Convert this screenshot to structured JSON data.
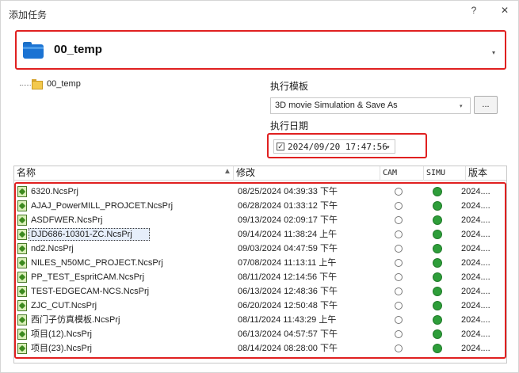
{
  "window": {
    "title": "添加任务",
    "help_label": "?",
    "close_label": "✕"
  },
  "folder_combo": {
    "name": "00_temp",
    "icon": "folder-icon",
    "arrow": "▾"
  },
  "tree": {
    "item_label": "00_temp"
  },
  "template": {
    "label": "执行模板",
    "selected": "3D movie Simulation  & Save As",
    "arrow": "▾",
    "browse_label": "..."
  },
  "exec_date": {
    "label": "执行日期",
    "checked": true,
    "check_mark": "✓",
    "value": "2024/09/20 17:47:56",
    "arrow": "▾"
  },
  "grid": {
    "columns": {
      "name": "名称",
      "modified": "修改",
      "cam": "CAM",
      "simu": "SIMU",
      "version": "版本"
    },
    "sort_arrow": "▲",
    "rows": [
      {
        "name": "6320.NcsPrj",
        "modified": "08/25/2024 04:39:33 下午",
        "version": "2024...."
      },
      {
        "name": "AJAJ_PowerMILL_PROJCET.NcsPrj",
        "modified": "06/28/2024 01:33:12 下午",
        "version": "2024...."
      },
      {
        "name": "ASDFWER.NcsPrj",
        "modified": "09/13/2024 02:09:17 下午",
        "version": "2024...."
      },
      {
        "name": "DJD686-10301-ZC.NcsPrj",
        "modified": "09/14/2024 11:38:24 上午",
        "version": "2024...."
      },
      {
        "name": "nd2.NcsPrj",
        "modified": "09/03/2024 04:47:59 下午",
        "version": "2024...."
      },
      {
        "name": "NILES_N50MC_PROJECT.NcsPrj",
        "modified": "07/08/2024 11:13:11 上午",
        "version": "2024...."
      },
      {
        "name": "PP_TEST_EspritCAM.NcsPrj",
        "modified": "08/11/2024 12:14:56 下午",
        "version": "2024...."
      },
      {
        "name": "TEST-EDGECAM-NCS.NcsPrj",
        "modified": "06/13/2024 12:48:36 下午",
        "version": "2024...."
      },
      {
        "name": "ZJC_CUT.NcsPrj",
        "modified": "06/20/2024 12:50:48 下午",
        "version": "2024...."
      },
      {
        "name": "西门子仿真模板.NcsPrj",
        "modified": "08/11/2024 11:43:29 上午",
        "version": "2024...."
      },
      {
        "name": "项目(12).NcsPrj",
        "modified": "06/13/2024 04:57:57 下午",
        "version": "2024...."
      },
      {
        "name": "项目(23).NcsPrj",
        "modified": "08/14/2024 08:28:00 下午",
        "version": "2024...."
      }
    ],
    "selected_row": 3
  },
  "colors": {
    "highlight_border": "#e02020",
    "simu_green": "#2e9e3a",
    "folder_blue": "#1b73d3"
  }
}
